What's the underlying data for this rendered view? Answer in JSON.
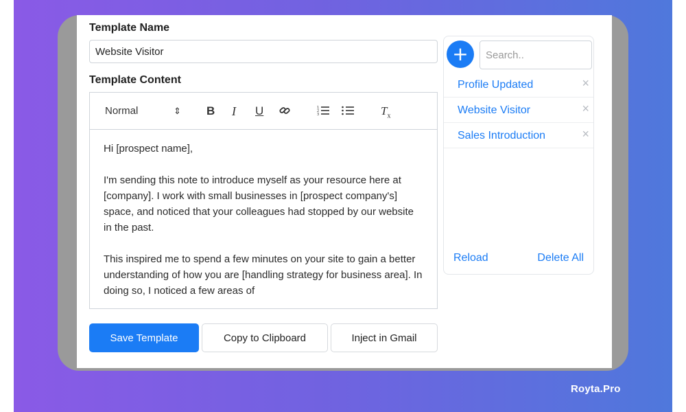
{
  "template_name": {
    "label": "Template Name",
    "value": "Website Visitor"
  },
  "template_content": {
    "label": "Template Content",
    "toolbar": {
      "style_select": "Normal",
      "style_caret": "⇕",
      "bold": "B",
      "italic": "I",
      "underline": "U",
      "link_icon": "🔗",
      "ordered_list_icon": "☰",
      "bullet_list_icon": "☰",
      "clear_format": "T"
    },
    "paragraphs": [
      "Hi [prospect name],",
      "I'm sending this note to introduce myself as your resource here at [company]. I work with small businesses in [prospect company's] space, and noticed that your colleagues had stopped by our website in the past.",
      "This inspired me to spend a few minutes on your site to gain a better understanding of how you are [handling strategy for business area]. In doing so, I noticed a few areas of"
    ]
  },
  "buttons": {
    "save": "Save Template",
    "copy": "Copy to Clipboard",
    "inject": "Inject in Gmail"
  },
  "side_panel": {
    "add_label": "+",
    "search_placeholder": "Search..",
    "templates": [
      {
        "name": "Profile Updated",
        "remove": "×"
      },
      {
        "name": "Website Visitor",
        "remove": "×"
      },
      {
        "name": "Sales Introduction",
        "remove": "×"
      }
    ],
    "reload": "Reload",
    "delete_all": "Delete All"
  },
  "watermark": "Royta.Pro",
  "colors": {
    "accent": "#1b7cf5",
    "gradient_start": "#8a5ae6",
    "gradient_end": "#4f78dc"
  }
}
